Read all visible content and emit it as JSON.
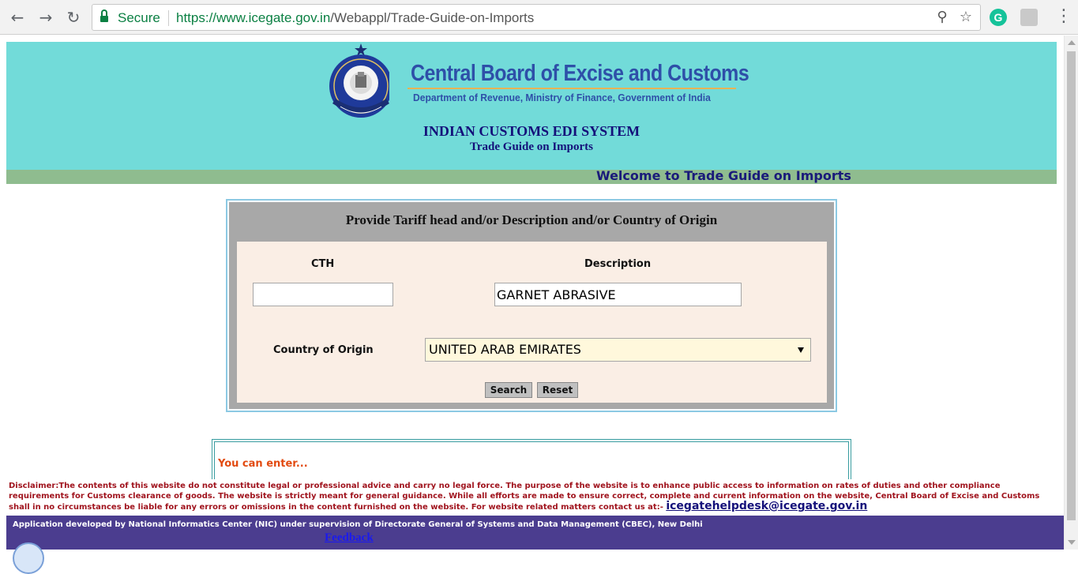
{
  "browser": {
    "secure_label": "Secure",
    "url_scheme": "https://",
    "url_host": "www.icegate.gov.in",
    "url_path": "/Webappl/Trade-Guide-on-Imports",
    "extension_g": "G"
  },
  "header": {
    "org_title": "Central Board of Excise and Customs",
    "org_subtitle": "Department of Revenue, Ministry of Finance, Government of India",
    "system_title": "INDIAN CUSTOMS EDI SYSTEM",
    "system_subtitle": "Trade Guide on Imports",
    "welcome": "Welcome to Trade Guide on Imports"
  },
  "form": {
    "heading": "Provide Tariff head and/or Description and/or Country of Origin",
    "cth_label": "CTH",
    "cth_value": "",
    "description_label": "Description",
    "description_value": "GARNET ABRASIVE",
    "country_label": "Country of Origin",
    "country_value": "UNITED ARAB EMIRATES",
    "search_label": "Search",
    "reset_label": "Reset"
  },
  "result": {
    "hint": "You can enter..."
  },
  "disclaimer": {
    "text": "Disclaimer:The contents of this website do not constitute legal or professional advice and carry no legal force. The purpose of the website is to enhance public access to information on rates of duties and other compliance requirements for Customs clearance of goods. The website is strictly meant for general guidance. While all efforts are made to ensure correct, complete and current information on the website, Central Board of Excise and Customs shall in no circumstances be liable for any errors or omissions in the content furnished on the website. For website related matters contact us at:- ",
    "email": "icegatehelpdesk@icegate.gov.in"
  },
  "footer": {
    "credit": "Application developed by National Informatics Center (NIC) under supervision of Directorate General of Systems and Data Management (CBEC), New Delhi",
    "feedback": "Feedback"
  },
  "colors": {
    "header_bg": "#72dbd9",
    "welcome_bar": "#8fbc8f",
    "footer_bg": "#4b3d8f",
    "secure_green": "#0b8043"
  }
}
